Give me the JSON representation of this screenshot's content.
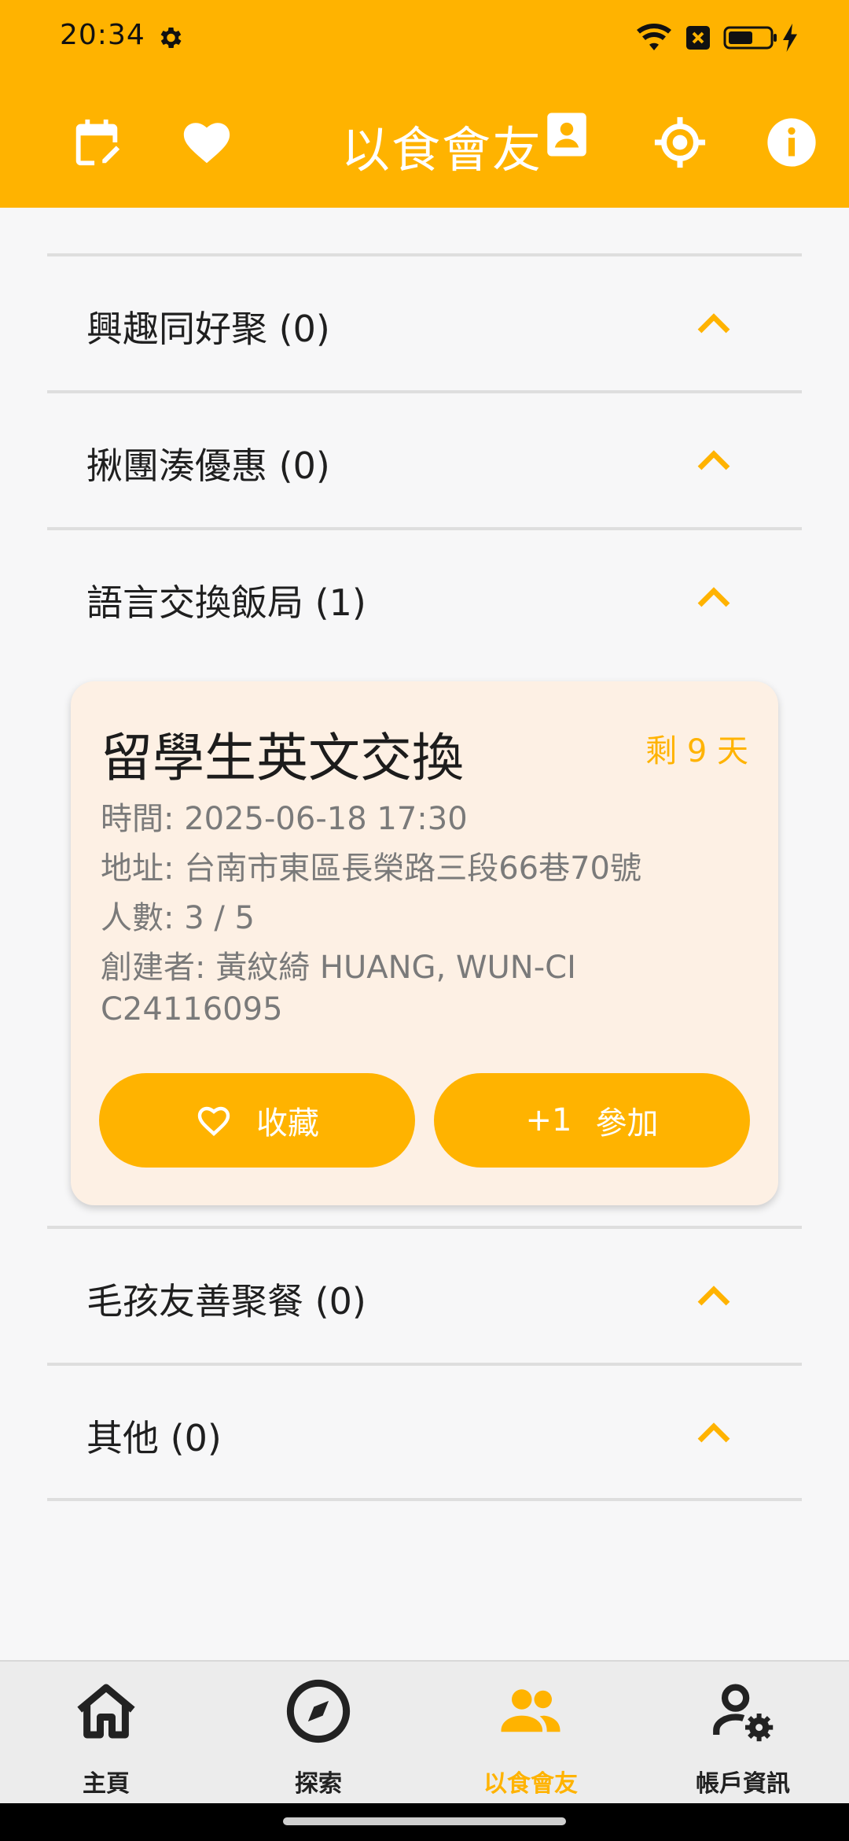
{
  "status_bar": {
    "time": "20:34",
    "icons": [
      "settings-gear-icon",
      "wifi-icon",
      "no-sim-icon",
      "battery-icon",
      "charging-bolt-icon"
    ]
  },
  "app_bar": {
    "title": "以食會友",
    "icons": [
      "calendar-edit-icon",
      "favorite-heart-icon",
      "contact-card-icon",
      "location-target-icon",
      "info-icon"
    ],
    "color": "#ffb300"
  },
  "sections": [
    {
      "label": "興趣同好聚 (0)"
    },
    {
      "label": "揪團湊優惠 (0)"
    },
    {
      "label": "語言交換飯局 (1)"
    },
    {
      "label": "毛孩友善聚餐 (0)"
    },
    {
      "label": "其他 (0)"
    }
  ],
  "event_card": {
    "title": "留學生英文交換",
    "remaining": "剩 9 天",
    "time": "時間: 2025-06-18 17:30",
    "address": "地址: 台南市東區長榮路三段66巷70號",
    "people": "人數:  3 / 5",
    "creator": "創建者:  黃紋綺 HUANG, WUN-CI",
    "creator_id": "C24116095",
    "favorite_label": "收藏",
    "join_prefix": "+1",
    "join_label": "參加",
    "card_bg": "#fdf0e4"
  },
  "bottom_nav": {
    "items": [
      {
        "label": "主頁",
        "icon": "home-icon",
        "active": false
      },
      {
        "label": "探索",
        "icon": "compass-icon",
        "active": false
      },
      {
        "label": "以食會友",
        "icon": "people-group-icon",
        "active": true
      },
      {
        "label": "帳戶資訊",
        "icon": "account-settings-icon",
        "active": false
      }
    ],
    "active_color": "#ffb300"
  }
}
